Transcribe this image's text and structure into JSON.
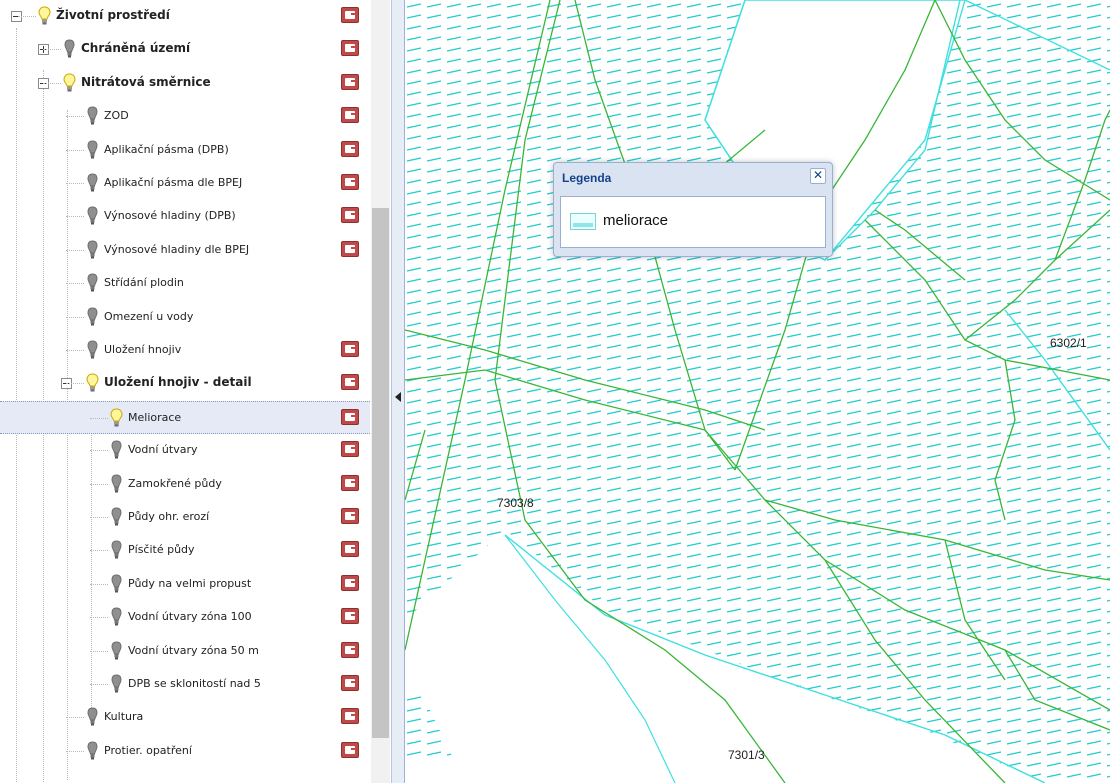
{
  "tree": {
    "items": [
      {
        "label": "Životní prostředí",
        "bold": true,
        "bulb": "yellow",
        "toggle": "minus",
        "legend": true
      },
      {
        "label": "Chráněná území",
        "bold": true,
        "bulb": "gray",
        "toggle": "plus",
        "legend": true
      },
      {
        "label": "Nitrátová směrnice",
        "bold": true,
        "bulb": "yellow",
        "toggle": "minus",
        "legend": true
      },
      {
        "label": "ZOD",
        "bold": false,
        "bulb": "gray",
        "legend": true
      },
      {
        "label": "Aplikační pásma (DPB)",
        "bold": false,
        "bulb": "gray",
        "legend": true
      },
      {
        "label": "Aplikační pásma dle BPEJ",
        "bold": false,
        "bulb": "gray",
        "legend": true
      },
      {
        "label": "Výnosové hladiny (DPB)",
        "bold": false,
        "bulb": "gray",
        "legend": true
      },
      {
        "label": "Výnosové hladiny dle BPEJ",
        "bold": false,
        "bulb": "gray",
        "legend": true
      },
      {
        "label": "Střídání plodin",
        "bold": false,
        "bulb": "gray",
        "legend": false
      },
      {
        "label": "Omezení u vody",
        "bold": false,
        "bulb": "gray",
        "legend": false
      },
      {
        "label": "Uložení hnojiv",
        "bold": false,
        "bulb": "gray",
        "legend": true
      },
      {
        "label": "Uložení hnojiv - detail",
        "bold": true,
        "bulb": "yellow",
        "toggle": "minus",
        "legend": true
      },
      {
        "label": "Meliorace",
        "bold": false,
        "bulb": "yellow",
        "legend": true,
        "selected": true
      },
      {
        "label": "Vodní útvary",
        "bold": false,
        "bulb": "gray",
        "legend": true
      },
      {
        "label": "Zamokřené půdy",
        "bold": false,
        "bulb": "gray",
        "legend": true
      },
      {
        "label": "Půdy ohr. erozí",
        "bold": false,
        "bulb": "gray",
        "legend": true
      },
      {
        "label": "Písčité půdy",
        "bold": false,
        "bulb": "gray",
        "legend": true
      },
      {
        "label": "Půdy na velmi propust",
        "bold": false,
        "bulb": "gray",
        "legend": true
      },
      {
        "label": "Vodní útvary zóna 100",
        "bold": false,
        "bulb": "gray",
        "legend": true
      },
      {
        "label": "Vodní útvary zóna 50 m",
        "bold": false,
        "bulb": "gray",
        "legend": true
      },
      {
        "label": "DPB se sklonitostí nad 5",
        "bold": false,
        "bulb": "gray",
        "legend": true
      },
      {
        "label": "Kultura",
        "bold": false,
        "bulb": "gray",
        "legend": true
      },
      {
        "label": "Protier. opatření",
        "bold": false,
        "bulb": "gray",
        "legend": true
      }
    ]
  },
  "map": {
    "parcels": [
      "6302/1",
      "7303/8",
      "7301/3"
    ],
    "colors": {
      "hatch": "#22cccc",
      "boundary": "#37b637",
      "outline": "#40e0e0"
    }
  },
  "legend_window": {
    "title": "Legenda",
    "close": "✕",
    "item_label": "meliorace"
  }
}
